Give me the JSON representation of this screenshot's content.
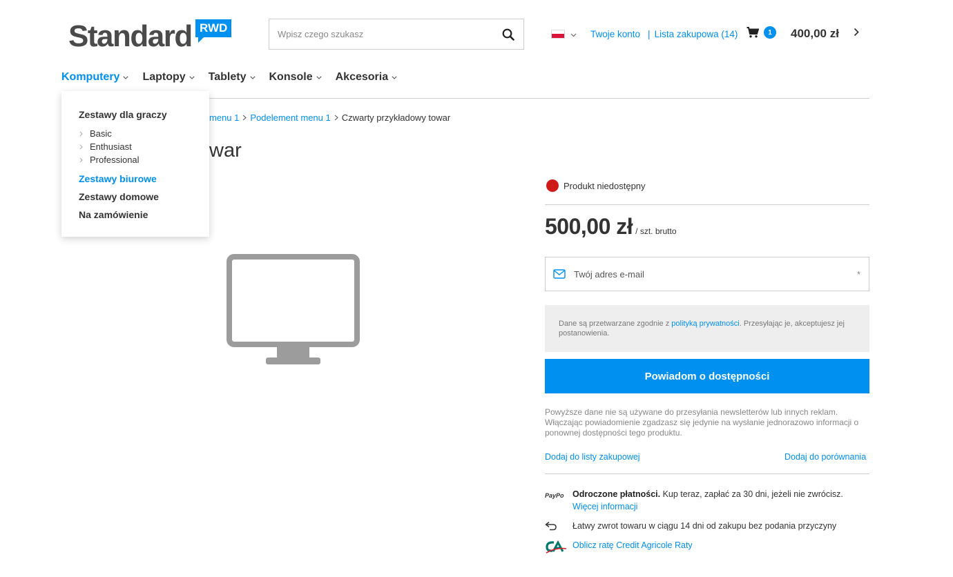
{
  "header": {
    "logo_text": "Standard",
    "logo_badge": "RWD",
    "search_placeholder": "Wpisz czego szukasz",
    "account_link": "Twoje konto",
    "separator": "|",
    "wishlist_link": "Lista zakupowa (14)",
    "cart_count": "1",
    "cart_total": "400,00 zł"
  },
  "nav": {
    "items": [
      {
        "label": "Komputery"
      },
      {
        "label": "Laptopy"
      },
      {
        "label": "Tablety"
      },
      {
        "label": "Konsole"
      },
      {
        "label": "Akcesoria"
      }
    ]
  },
  "dropdown": {
    "group_title": "Zestawy dla graczy",
    "sub_items": [
      "Basic",
      "Enthusiast",
      "Professional"
    ],
    "categories": [
      "Zestawy biurowe",
      "Zestawy domowe",
      "Na zamówienie"
    ]
  },
  "breadcrumb": {
    "items": [
      "menu 1",
      "Podelement menu 1"
    ],
    "current": "Czwarty przykładowy towar"
  },
  "product": {
    "title_visible": "war",
    "availability": "Produkt niedostępny",
    "price": "500,00 zł",
    "price_unit": "/ szt. brutto",
    "email_placeholder": "Twój adres e-mail",
    "required_mark": "*",
    "privacy_before": "Dane są przetwarzane zgodnie z ",
    "privacy_link": "polityką prywatności",
    "privacy_after": ". Przesyłając je, akceptujesz jej postanowienia.",
    "notify_button": "Powiadom o dostępności",
    "disclaimer": "Powyższe dane nie są używane do przesyłania newsletterów lub innych reklam. Włączając powiadomienie zgadzasz się jedynie na wysłanie jednorazowo informacji o ponownej dostępności tego produktu.",
    "add_to_list": "Dodaj do listy zakupowej",
    "add_to_compare": "Dodaj do porównania"
  },
  "features": {
    "paypo_logo": "PayPo",
    "deferred_bold": "Odroczone płatności.",
    "deferred_text": " Kup teraz, zapłać za 30 dni, jeżeli nie zwrócisz.",
    "more_info": "Więcej informacji",
    "return_text": "Łatwy zwrot towaru w ciągu 14 dni od zakupu bez podania przyczyny",
    "credit_link": "Oblicz ratę Credit Agricole Raty"
  },
  "colors": {
    "accent": "#0090f0",
    "unavailable": "#d01a1a",
    "text": "#333333"
  }
}
